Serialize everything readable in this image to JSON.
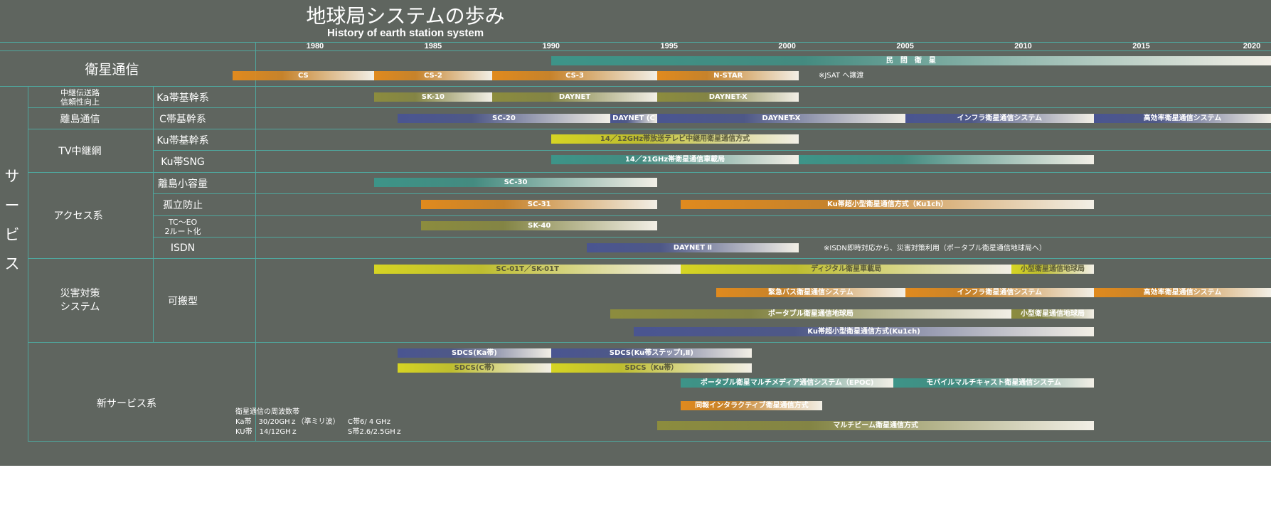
{
  "title": "地球局システムの歩み",
  "subtitle": "History of earth station system",
  "axis": {
    "years": [
      "1980",
      "1985",
      "1990",
      "1995",
      "2000",
      "2005",
      "2010",
      "2015",
      "2020"
    ],
    "start_year": 1977.5,
    "end_year": 2020.5
  },
  "colors": {
    "teal": "#3d9488",
    "orange": "#e08a1e",
    "olive": "#8c8c3e",
    "navy": "#4a5591",
    "yellow": "#d6d423",
    "background": "#5f655f",
    "grid": "#4fa79e"
  },
  "sections": {
    "satellite_comm": "衛星通信",
    "service": "サービス",
    "relay": "中継伝送路\n信頼性向上",
    "island": "離島通信",
    "tv": "TV中継網",
    "access": "アクセス系",
    "disaster": "災害対策\nシステム",
    "new_service": "新サービス系"
  },
  "subsections": {
    "ka_trunk": "Ka帯基幹系",
    "c_trunk": "C帯基幹系",
    "ku_trunk": "Ku帯基幹系",
    "ku_sng": "Ku帯SNG",
    "island_small": "離島小容量",
    "isolation": "孤立防止",
    "tc_eo": "TC～EO\n2ルート化",
    "isdn": "ISDN",
    "portable": "可搬型"
  },
  "chart_data": {
    "type": "gantt",
    "title": "地球局システムの歩み",
    "subtitle": "History of earth station system",
    "xlim": [
      1977.5,
      2020.5
    ],
    "xticks": [
      1980,
      1985,
      1990,
      1995,
      2000,
      2005,
      2010,
      2015,
      2020
    ],
    "bars": [
      {
        "label": "民　間　衛　星",
        "start": 1990.0,
        "end": 2020.5,
        "color": "teal",
        "row": 0
      },
      {
        "label": "CS",
        "start": 1976.5,
        "end": 1982.5,
        "color": "orange",
        "row": 1
      },
      {
        "label": "CS-2",
        "start": 1982.5,
        "end": 1987.5,
        "color": "orange",
        "row": 1
      },
      {
        "label": "CS-3",
        "start": 1987.5,
        "end": 1994.5,
        "color": "orange",
        "row": 1
      },
      {
        "label": "N-STAR",
        "start": 1994.5,
        "end": 2000.5,
        "color": "orange",
        "row": 1
      },
      {
        "label": "SK-10",
        "start": 1982.5,
        "end": 1987.5,
        "color": "olive",
        "row": 2
      },
      {
        "label": "DAYNET",
        "start": 1987.5,
        "end": 1994.5,
        "color": "olive",
        "row": 2
      },
      {
        "label": "DAYNET-X",
        "start": 1994.5,
        "end": 2000.5,
        "color": "olive",
        "row": 2
      },
      {
        "label": "SC-20",
        "start": 1983.5,
        "end": 1992.5,
        "color": "navy",
        "row": 3
      },
      {
        "label": "DAYNET (C",
        "start": 1992.5,
        "end": 1994.5,
        "color": "navy",
        "row": 3
      },
      {
        "label": "DAYNET-X",
        "start": 1994.5,
        "end": 2005.0,
        "color": "navy",
        "row": 3
      },
      {
        "label": "インフラ衛星通信システム",
        "start": 2005.0,
        "end": 2013.0,
        "color": "navy",
        "row": 3
      },
      {
        "label": "高効率衛星通信システム",
        "start": 2013.0,
        "end": 2020.5,
        "color": "navy",
        "row": 3
      },
      {
        "label": "14／12GHz帯放送テレビ中継用衛星通信方式",
        "start": 1990.0,
        "end": 2000.5,
        "color": "yellow",
        "row": 4
      },
      {
        "label": "14／21GHz帯衛星通信車載局",
        "start": 1990.0,
        "end": 2000.5,
        "color": "teal",
        "row": 5
      },
      {
        "label": "",
        "start": 2000.5,
        "end": 2013.0,
        "color": "teal",
        "row": 5
      },
      {
        "label": "SC-30",
        "start": 1982.5,
        "end": 1994.5,
        "color": "teal",
        "row": 6
      },
      {
        "label": "SC-31",
        "start": 1984.5,
        "end": 1994.5,
        "color": "orange",
        "row": 7
      },
      {
        "label": "Ku帯超小型衛星通信方式（Ku1ch）",
        "start": 1995.5,
        "end": 2013.0,
        "color": "orange",
        "row": 7
      },
      {
        "label": "SK-40",
        "start": 1984.5,
        "end": 1994.5,
        "color": "olive",
        "row": 8
      },
      {
        "label": "DAYNET Ⅱ",
        "start": 1991.5,
        "end": 2000.5,
        "color": "navy",
        "row": 9
      },
      {
        "label": "SC-01T／SK-01T",
        "start": 1982.5,
        "end": 1995.5,
        "color": "yellow",
        "row": 10
      },
      {
        "label": "ディジタル衛星車載局",
        "start": 1995.5,
        "end": 2009.5,
        "color": "yellow",
        "row": 10
      },
      {
        "label": "小型衛星通信地球局",
        "start": 2009.5,
        "end": 2013.0,
        "color": "yellow",
        "row": 10
      },
      {
        "label": "緊急バス衛星通信システム",
        "start": 1997.0,
        "end": 2005.0,
        "color": "orange",
        "row": 11
      },
      {
        "label": "インフラ衛星通信システム",
        "start": 2005.0,
        "end": 2013.0,
        "color": "orange",
        "row": 11
      },
      {
        "label": "高効率衛星通信システム",
        "start": 2013.0,
        "end": 2020.5,
        "color": "orange",
        "row": 11
      },
      {
        "label": "ポータブル衛星通信地球局",
        "start": 1992.5,
        "end": 2009.5,
        "color": "olive",
        "row": 12
      },
      {
        "label": "小型衛星通信地球局",
        "start": 2009.5,
        "end": 2013.0,
        "color": "olive",
        "row": 12
      },
      {
        "label": "Ku帯超小型衛星通信方式(Ku1ch)",
        "start": 1993.5,
        "end": 2013.0,
        "color": "navy",
        "row": 13
      },
      {
        "label": "SDCS(Ka帯)",
        "start": 1983.5,
        "end": 1990.0,
        "color": "navy",
        "row": 14
      },
      {
        "label": "SDCS(Ku帯ステップⅠ,Ⅱ)",
        "start": 1990.0,
        "end": 1998.5,
        "color": "navy",
        "row": 14
      },
      {
        "label": "SDCS(C帯)",
        "start": 1983.5,
        "end": 1990.0,
        "color": "yellow",
        "row": 15
      },
      {
        "label": "SDCS（Ku帯）",
        "start": 1990.0,
        "end": 1998.5,
        "color": "yellow",
        "row": 15
      },
      {
        "label": "ポータブル衛星マルチメディア通信システム（EPOC)",
        "start": 1995.5,
        "end": 2004.5,
        "color": "teal",
        "row": 16
      },
      {
        "label": "モバイルマルチキャスト衛星通信システム",
        "start": 2004.5,
        "end": 2013.0,
        "color": "teal",
        "row": 16
      },
      {
        "label": "同報インタラクティブ衛星通信方式",
        "start": 1995.5,
        "end": 2001.5,
        "color": "orange",
        "row": 17
      },
      {
        "label": "マルチビーム衛星通信方式",
        "start": 1994.5,
        "end": 2013.0,
        "color": "olive",
        "row": 18
      }
    ]
  },
  "notes": {
    "jsat": "※JSAT へ譲渡",
    "isdn": "※ISDN即時対応から、災害対策利用（ポータブル衛星通信地球局へ）"
  },
  "frequency": {
    "title": "衛星通信の周波数帯",
    "ka": "Ka帯　30/20GHｚ（準ミリ波）",
    "c": "C帯6/ 4 GHz",
    "ku": "KU帯　14/12GHｚ",
    "s": "S帯2.6/2.5GHｚ"
  }
}
